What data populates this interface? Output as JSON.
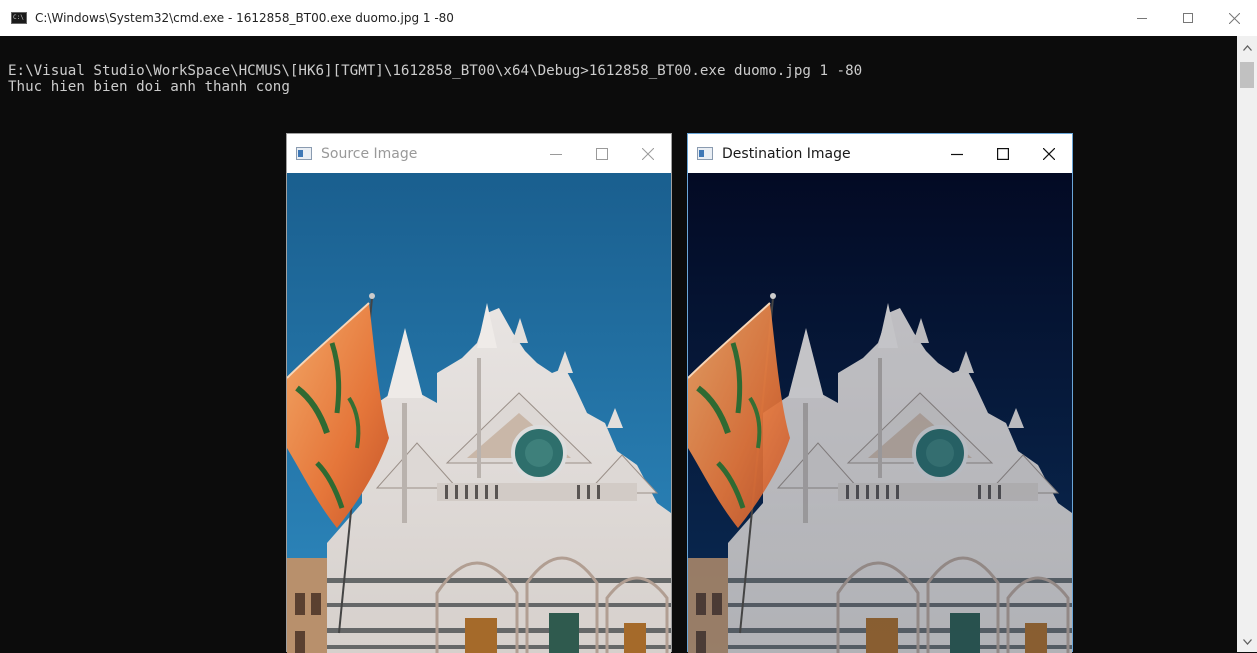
{
  "console_window": {
    "title": "C:\\Windows\\System32\\cmd.exe - 1612858_BT00.exe  duomo.jpg 1 -80",
    "icon": "console-app-icon",
    "controls": [
      "minimize-icon",
      "maximize-icon",
      "close-icon"
    ]
  },
  "console": {
    "lines": [
      "E:\\Visual Studio\\WorkSpace\\HCMUS\\[HK6][TGMT]\\1612858_BT00\\x64\\Debug>1612858_BT00.exe duomo.jpg 1 -80",
      "Thuc hien bien doi anh thanh cong"
    ]
  },
  "source_window": {
    "title": "Source Image",
    "state": "inactive",
    "colors": {
      "sky_top": "#1a5f8f",
      "sky_bottom": "#2e8ac0"
    }
  },
  "destination_window": {
    "title": "Destination Image",
    "state": "active",
    "colors": {
      "sky_top": "#030a24",
      "sky_bottom": "#0a2c56"
    }
  }
}
